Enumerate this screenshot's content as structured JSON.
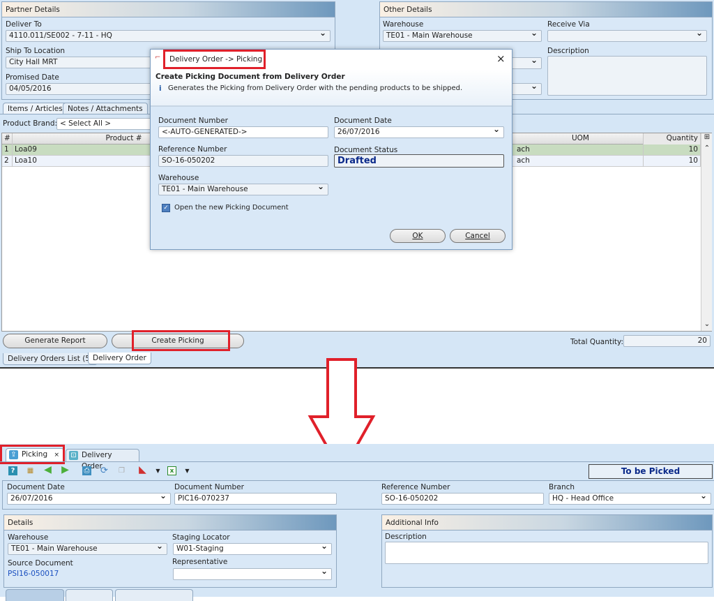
{
  "top": {
    "partner": {
      "title": "Partner Details",
      "deliver_to_label": "Deliver To",
      "deliver_to": "4110.011/SE002 - 7-11 - HQ",
      "ship_to_label": "Ship To Location",
      "ship_to": "City Hall MRT",
      "promised_label": "Promised Date",
      "promised": "04/05/2016"
    },
    "other": {
      "title": "Other Details",
      "warehouse_label": "Warehouse",
      "warehouse": "TE01 - Main Warehouse",
      "receive_label": "Receive Via",
      "receive": "",
      "description_label": "Description"
    },
    "tabs": [
      "Items / Articles",
      "Notes / Attachments"
    ],
    "brand_label": "Product Brand:",
    "brand": "< Select All >",
    "grid": {
      "headers": [
        "#",
        "Product #",
        "UOM",
        "Quantity"
      ],
      "rows": [
        {
          "n": "1",
          "product": "Loa09",
          "uom": "ach",
          "qty": "10"
        },
        {
          "n": "2",
          "product": "Loa10",
          "uom": "ach",
          "qty": "10"
        }
      ]
    },
    "generate_report": "Generate Report",
    "create_picking": "Create Picking",
    "total_label": "Total Quantity:",
    "total": "20",
    "bottom_tabs": [
      "Delivery Orders List (5)",
      "Delivery Order"
    ]
  },
  "dialog": {
    "title": "Delivery Order -> Picking",
    "heading": "Create Picking Document from Delivery Order",
    "info": "Generates the Picking from Delivery Order with the pending products to be shipped.",
    "doc_number_label": "Document Number",
    "doc_number": "<-AUTO-GENERATED->",
    "doc_date_label": "Document Date",
    "doc_date": "26/07/2016",
    "ref_label": "Reference Number",
    "ref": "SO-16-050202",
    "status_label": "Document Status",
    "status": "Drafted",
    "warehouse_label": "Warehouse",
    "warehouse": "TE01 - Main Warehouse",
    "open_label": "Open the new Picking Document",
    "open_checked": true,
    "ok": "OK",
    "cancel": "Cancel"
  },
  "bottom": {
    "tabs": [
      "Picking",
      "Delivery Order"
    ],
    "status": "To be Picked",
    "doc_date_label": "Document Date",
    "doc_date": "26/07/2016",
    "doc_number_label": "Document Number",
    "doc_number": "PIC16-070237",
    "ref_label": "Reference Number",
    "ref": "SO-16-050202",
    "branch_label": "Branch",
    "branch": "HQ - Head Office",
    "details": {
      "title": "Details",
      "warehouse_label": "Warehouse",
      "warehouse": "TE01 - Main Warehouse",
      "staging_label": "Staging Locator",
      "staging": "W01-Staging",
      "source_label": "Source Document",
      "source": "PSI16-050017",
      "rep_label": "Representative",
      "rep": ""
    },
    "additional": {
      "title": "Additional Info",
      "description_label": "Description"
    }
  },
  "colors": {
    "highlight": "#e0202a",
    "link": "#1a4fc0",
    "status": "#0b2a8a"
  }
}
